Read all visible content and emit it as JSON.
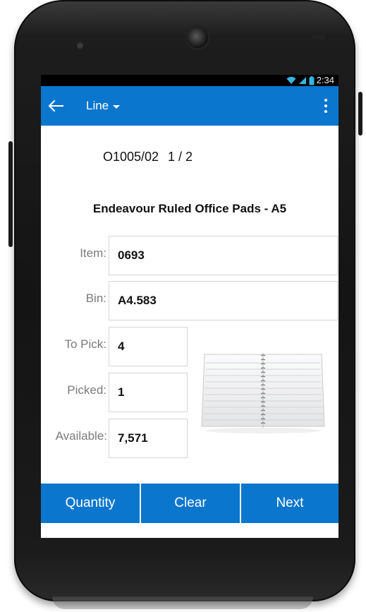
{
  "status_bar": {
    "time": "2:34",
    "icons": [
      "wifi-icon",
      "signal-icon",
      "battery-icon"
    ]
  },
  "app_bar": {
    "back_icon": "arrow-left-icon",
    "title": "Line",
    "title_menu_icon": "caret-down-icon",
    "overflow_icon": "more-vertical-icon"
  },
  "order": {
    "number": "O1005/02",
    "position": "1 / 2"
  },
  "product": {
    "name": "Endeavour Ruled Office Pads - A5",
    "image_icon": "notepad-image"
  },
  "fields": {
    "item": {
      "label": "Item:",
      "value": "0693"
    },
    "bin": {
      "label": "Bin:",
      "value": "A4.583"
    },
    "to_pick": {
      "label": "To Pick:",
      "value": "4"
    },
    "picked": {
      "label": "Picked:",
      "value": "1"
    },
    "available": {
      "label": "Available:",
      "value": "7,571"
    }
  },
  "buttons": {
    "quantity": "Quantity",
    "clear": "Clear",
    "next": "Next"
  },
  "colors": {
    "accent": "#0a76cd",
    "phone_body": "#141414",
    "label_gray": "#7a7a7a",
    "field_border": "#d6d6d6"
  }
}
